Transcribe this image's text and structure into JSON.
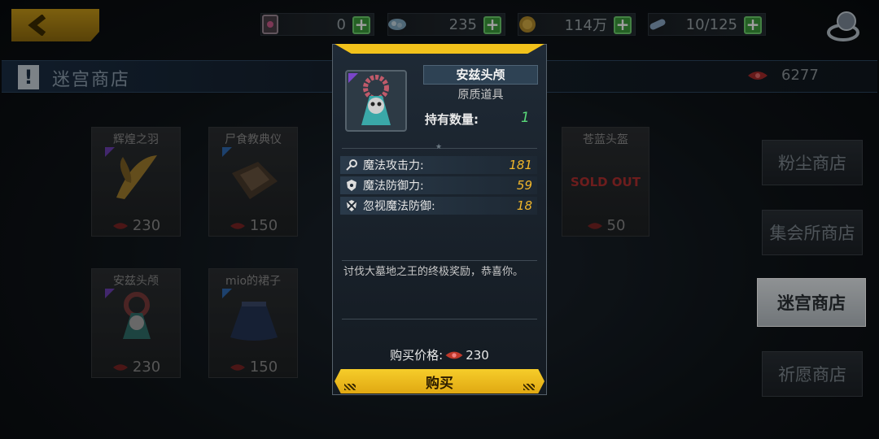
{
  "topbar": {
    "resources": [
      {
        "icon": "ticket-icon",
        "value": "0"
      },
      {
        "icon": "crystal-icon",
        "value": "235"
      },
      {
        "icon": "gold-coin-icon",
        "value": "114万"
      },
      {
        "icon": "stamina-capsule-icon",
        "value": "10/125"
      }
    ]
  },
  "shop": {
    "title": "迷宫商店",
    "currency_total": "6277"
  },
  "items": [
    {
      "name": "辉煌之羽",
      "price": "230"
    },
    {
      "name": "尸食教典仪",
      "price": "150"
    },
    {
      "name": "安兹头颅",
      "price": "230"
    },
    {
      "name": "mio的裙子",
      "price": "150"
    },
    {
      "name": "苍蓝头盔",
      "price": "50",
      "badge": "SOLD OUT"
    }
  ],
  "tabs": [
    {
      "label": "粉尘商店",
      "active": false
    },
    {
      "label": "集会所商店",
      "active": false
    },
    {
      "label": "迷宫商店",
      "active": true
    },
    {
      "label": "祈愿商店",
      "active": false
    }
  ],
  "popup": {
    "name": "安兹头颅",
    "type": "原质道具",
    "hold_label": "持有数量:",
    "hold_value": "1",
    "stats": [
      {
        "icon": "magic-attack-icon",
        "label": "魔法攻击力:",
        "value": "181"
      },
      {
        "icon": "magic-defense-icon",
        "label": "魔法防御力:",
        "value": "59"
      },
      {
        "icon": "ignore-magic-defense-icon",
        "label": "忽视魔法防御:",
        "value": "18"
      }
    ],
    "description": "讨伐大墓地之王的终极奖励，恭喜你。",
    "price_label": "购买价格:",
    "price_value": "230",
    "buy_label": "购买"
  },
  "colors": {
    "accent": "#f2c21b",
    "stat_value": "#f2b72a",
    "hold_value": "#58d878"
  }
}
